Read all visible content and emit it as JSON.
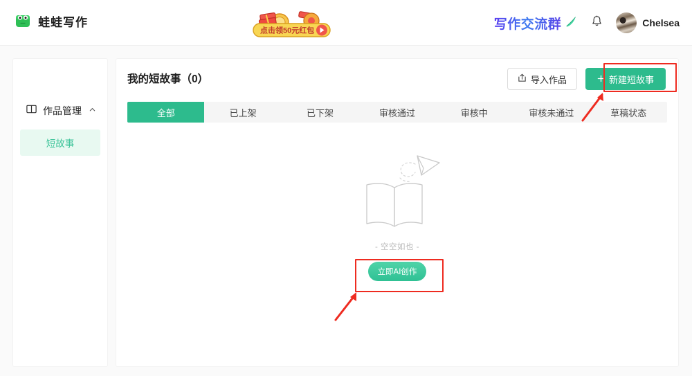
{
  "header": {
    "brand_name": "蛙蛙写作",
    "brand_icon": "frog-logo-icon",
    "banner_text": "点击领50元红包",
    "banner_play_icon": "play-icon",
    "group_link_text": "写作交流群",
    "group_pen_icon": "pen-icon",
    "bell_icon": "bell-icon",
    "avatar_icon": "user-avatar",
    "user_name": "Chelsea"
  },
  "sidebar": {
    "section_icon": "book-icon",
    "section_label": "作品管理",
    "collapse_icon": "chevron-up-icon",
    "items": [
      {
        "label": "短故事",
        "active": true
      }
    ]
  },
  "main": {
    "page_title": "我的短故事（0）",
    "import_button": {
      "label": "导入作品",
      "icon": "import-icon"
    },
    "new_button": {
      "label": "新建短故事",
      "icon": "plus-icon"
    },
    "tabs": [
      {
        "label": "全部",
        "active": true
      },
      {
        "label": "已上架",
        "active": false
      },
      {
        "label": "已下架",
        "active": false
      },
      {
        "label": "审核通过",
        "active": false
      },
      {
        "label": "审核中",
        "active": false
      },
      {
        "label": "审核未通过",
        "active": false
      },
      {
        "label": "草稿状态",
        "active": false
      }
    ],
    "empty_state": {
      "illustration_icon": "open-book-paper-plane-illustration",
      "text": "- 空空如也 -",
      "cta_label": "立即AI创作"
    }
  },
  "annotations": {
    "highlight_new_button": "red-box-new-story-button",
    "highlight_cta_button": "red-box-ai-create-button",
    "arrow_to_new_button": "red-arrow-up-right",
    "arrow_to_cta_button": "red-arrow-up-right"
  },
  "colors": {
    "accent_green": "#2dbb8d",
    "light_green_bg": "#e8f9f1",
    "annotation_red": "#ee2b20",
    "page_bg": "#fafafa"
  }
}
